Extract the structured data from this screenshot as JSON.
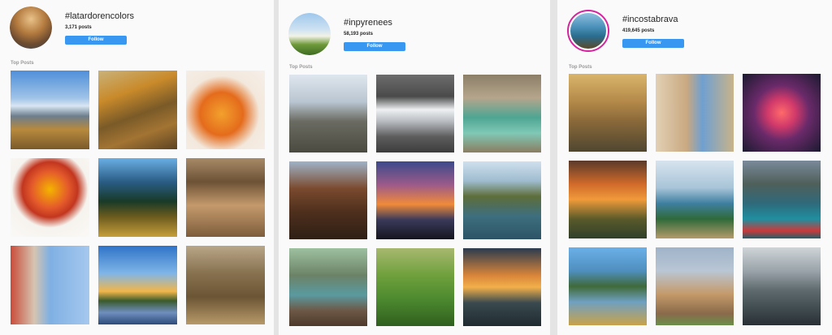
{
  "panels": [
    {
      "hashtag": "#latardorencolors",
      "post_count": "3,171 posts",
      "follow_label": "Follow",
      "section_label": "Top Posts"
    },
    {
      "hashtag": "#inpyrenees",
      "post_count": "58,193 posts",
      "follow_label": "Follow",
      "section_label": "Top Posts"
    },
    {
      "hashtag": "#incostabrava",
      "post_count": "419,645 posts",
      "follow_label": "Follow",
      "section_label": "Top Posts"
    }
  ],
  "colors": {
    "follow_button": "#3897f0",
    "story_ring": "#d6249f",
    "background": "#fafafa"
  }
}
